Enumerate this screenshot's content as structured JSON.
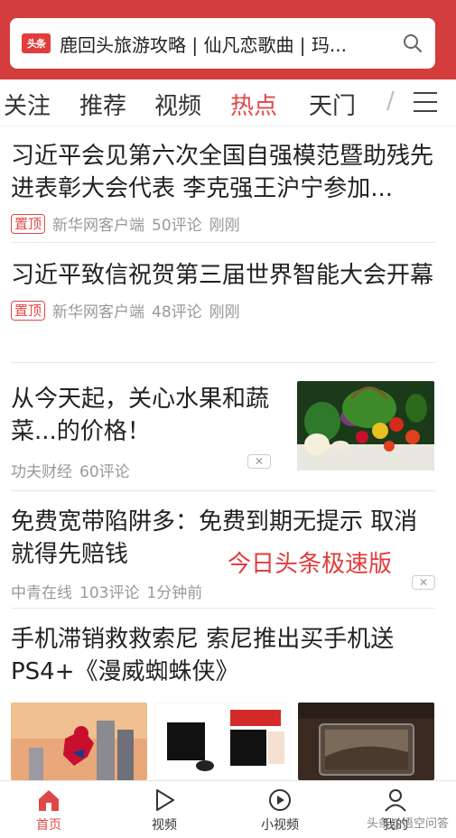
{
  "search": {
    "logo_text": "头条",
    "query": "鹿回头旅游攻略 | 仙凡恋歌曲 | 玛..."
  },
  "tabs": [
    {
      "label": "关注"
    },
    {
      "label": "推荐"
    },
    {
      "label": "视频"
    },
    {
      "label": "热点"
    },
    {
      "label": "天门"
    }
  ],
  "active_tab": "热点",
  "news": [
    {
      "title": "习近平会见第六次全国自强模范暨助残先进表彰大会代表 李克强王沪宁参加...",
      "pin": "置顶",
      "source": "新华网客户端",
      "comments": "50评论",
      "time": "刚刚"
    },
    {
      "title": "习近平致信祝贺第三届世界智能大会开幕",
      "pin": "置顶",
      "source": "新华网客户端",
      "comments": "48评论",
      "time": "刚刚"
    },
    {
      "title": "从今天起，关心水果和蔬菜...的价格！",
      "source": "功夫财经",
      "comments": "60评论"
    },
    {
      "title": "免费宽带陷阱多：免费到期无提示 取消就得先赔钱",
      "source": "中青在线",
      "comments": "103评论",
      "time": "1分钟前"
    },
    {
      "title": "手机滞销救救索尼 索尼推出买手机送PS4+《漫威蜘蛛侠》"
    }
  ],
  "watermark": "今日头条极速版",
  "bottom_nav": [
    {
      "label": "首页"
    },
    {
      "label": "视频"
    },
    {
      "label": "小视频"
    },
    {
      "label": "我的"
    }
  ],
  "brand_watermark": "头条@悟空问答",
  "colors": {
    "accent": "#d43d3d",
    "active": "#e04848"
  }
}
